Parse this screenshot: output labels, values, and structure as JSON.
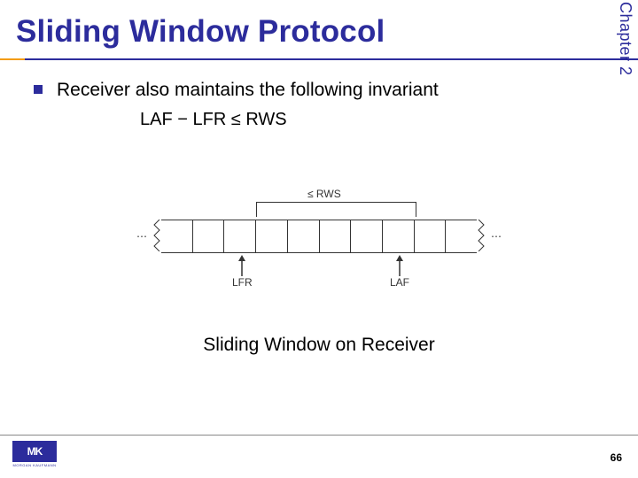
{
  "header": {
    "chapter": "Chapter 2",
    "title": "Sliding Window Protocol"
  },
  "body": {
    "bullet": "Receiver also maintains the following invariant",
    "invariant": "LAF − LFR ≤ RWS"
  },
  "diagram": {
    "bracket_label": "≤ RWS",
    "lfr_label": "LFR",
    "laf_label": "LAF",
    "ellipsis": "⋯",
    "caption": "Sliding Window on Receiver"
  },
  "footer": {
    "logo_text": "MK",
    "logo_sub": "MORGAN KAUFMANN",
    "page": "66"
  }
}
